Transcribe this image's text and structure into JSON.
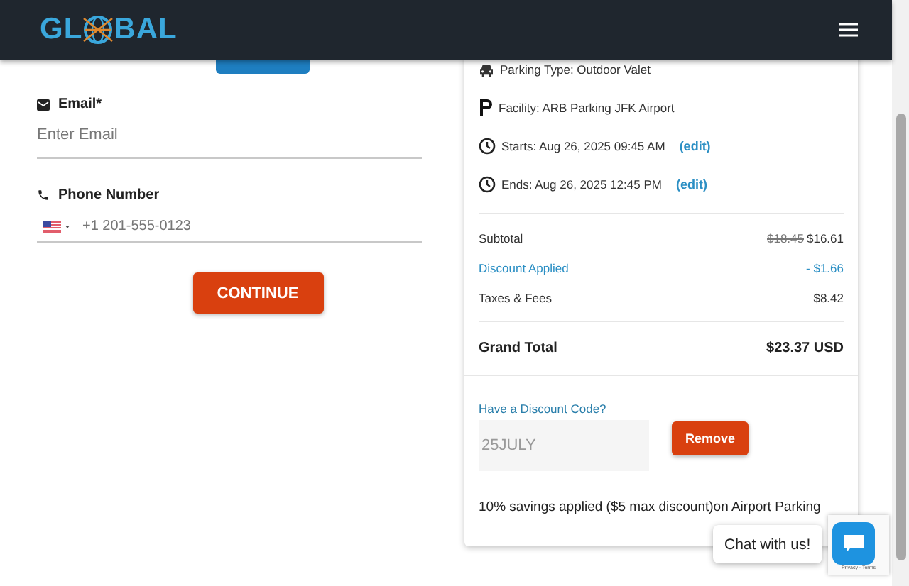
{
  "header": {
    "logo_left": "GL",
    "logo_right": "BAL"
  },
  "email": {
    "label": "Email*",
    "placeholder": "Enter Email"
  },
  "phone": {
    "label": "Phone Number",
    "placeholder": "+1 201-555-0123"
  },
  "continue_button": "CONTINUE",
  "details": [
    {
      "kind": "car",
      "text": "Parking Type: Outdoor Valet"
    },
    {
      "kind": "parking",
      "text": "Facility: ARB Parking JFK Airport"
    },
    {
      "kind": "clock",
      "text": "Starts: Aug 26, 2025 09:45 AM",
      "link": "(edit)"
    },
    {
      "kind": "clock",
      "text": "Ends: Aug 26, 2025 12:45 PM",
      "link": "(edit)"
    }
  ],
  "price_rows": [
    {
      "kind": "plain",
      "label": "Subtotal",
      "old_value": "$18.45",
      "value": "$16.61"
    },
    {
      "kind": "discount",
      "label": "Discount Applied",
      "value": "- $1.66"
    },
    {
      "kind": "plain",
      "label": "Taxes & Fees",
      "value": "$8.42"
    }
  ],
  "grand_total": {
    "label": "Grand Total",
    "value": "$23.37 USD"
  },
  "discount": {
    "label": "Have a Discount Code?",
    "value": "25JULY",
    "disabled": true,
    "button": "Remove",
    "note": "10% savings applied ($5 max discount)on Airport Parking"
  },
  "chat": {
    "label": "Chat with us!"
  },
  "recaptcha": {
    "text": "Privacy - Terms"
  }
}
